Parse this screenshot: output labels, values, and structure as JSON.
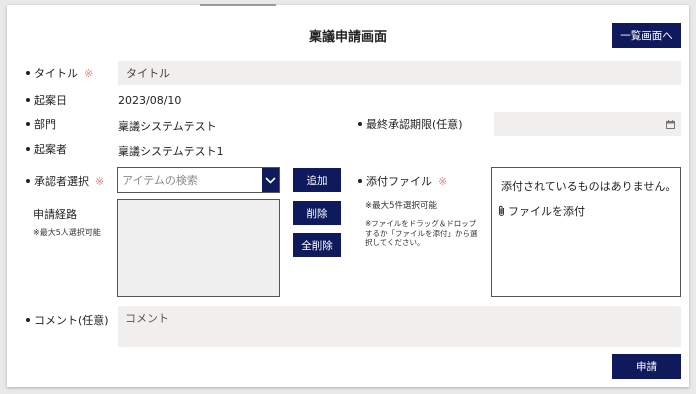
{
  "page": {
    "title": "稟議申請画面",
    "list_button_label": "一覧画面へ"
  },
  "form": {
    "title_label": "タイトル",
    "title_required_mark": "※",
    "title_value": "タイトル",
    "created_date_label": "起案日",
    "created_date_value": "2023/08/10",
    "department_label": "部門",
    "department_value": "稟議システムテスト",
    "deadline_label": "最終承認期限(任意)",
    "deadline_value": "",
    "drafter_label": "起案者",
    "drafter_value": "稟議システムテスト1",
    "approver_label": "承認者選択",
    "approver_required_mark": "※",
    "approver_search_placeholder": "アイテムの検索",
    "add_button_label": "追加",
    "delete_button_label": "削除",
    "delete_all_button_label": "全削除",
    "route_label": "申請経路",
    "route_note": "※最大5人選択可能",
    "attachment_label": "添付ファイル",
    "attachment_required_mark": "※",
    "attachment_max_note": "※最大5件選択可能",
    "attachment_help_note": "※ファイルをドラッグ＆ドロップするか「ファイルを添付」から選択してください。",
    "attachment_empty_text": "添付されているものはありません。",
    "attach_file_label": "ファイルを添付",
    "comment_label": "コメント(任意)",
    "comment_placeholder": "コメント",
    "submit_button_label": "申請"
  },
  "colors": {
    "accent_navy": "#0f1a5c",
    "required_mark": "#e88a8a",
    "field_background": "#f0efed"
  },
  "icons": {
    "calendar": "calendar-icon",
    "dropdown": "chevron-down-icon",
    "attach": "paperclip-icon"
  }
}
